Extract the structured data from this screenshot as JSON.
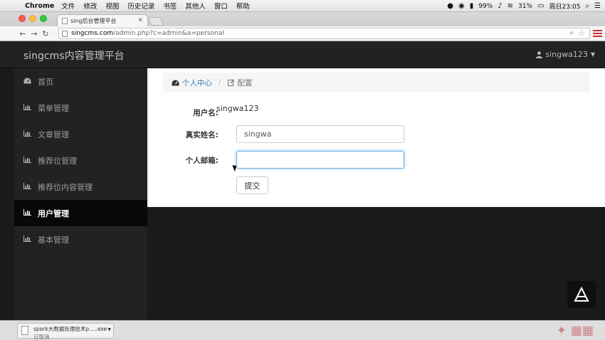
{
  "menubar": {
    "app": "Chrome",
    "items": [
      "文件",
      "修改",
      "视图",
      "历史记录",
      "书签",
      "其他人",
      "窗口",
      "帮助"
    ],
    "battery_text": "99%",
    "wifi_signal": "31%",
    "clock": "周日23:05"
  },
  "browser": {
    "tab_title": "sing后台管理平台",
    "url_host": "singcms.com",
    "url_path": "/admin.php?c=admin&a=personal"
  },
  "navbar": {
    "brand": "singcms内容管理平台",
    "username": "singwa123"
  },
  "sidebar": {
    "items": [
      {
        "label": "首页",
        "icon": "dashboard-icon"
      },
      {
        "label": "菜单管理",
        "icon": "bar-chart-icon"
      },
      {
        "label": "文章管理",
        "icon": "bar-chart-icon"
      },
      {
        "label": "推荐位管理",
        "icon": "bar-chart-icon"
      },
      {
        "label": "推荐位内容管理",
        "icon": "bar-chart-icon"
      },
      {
        "label": "用户管理",
        "icon": "bar-chart-icon",
        "active": true
      },
      {
        "label": "基本管理",
        "icon": "bar-chart-icon"
      }
    ]
  },
  "breadcrumb": {
    "home": "个人中心",
    "current": "配置"
  },
  "form": {
    "username_label": "用户名:",
    "username_value": "singwa123",
    "realname_label": "真实姓名:",
    "realname_value": "singwa",
    "email_label": "个人邮箱:",
    "email_value": "",
    "submit_label": "提交"
  },
  "download": {
    "filename": "spark大数据处理技术p.....exe",
    "status": "已取消"
  },
  "colors": {
    "navbar_bg": "#222222",
    "link_blue": "#337ab7",
    "focus_border": "#66afe9"
  }
}
